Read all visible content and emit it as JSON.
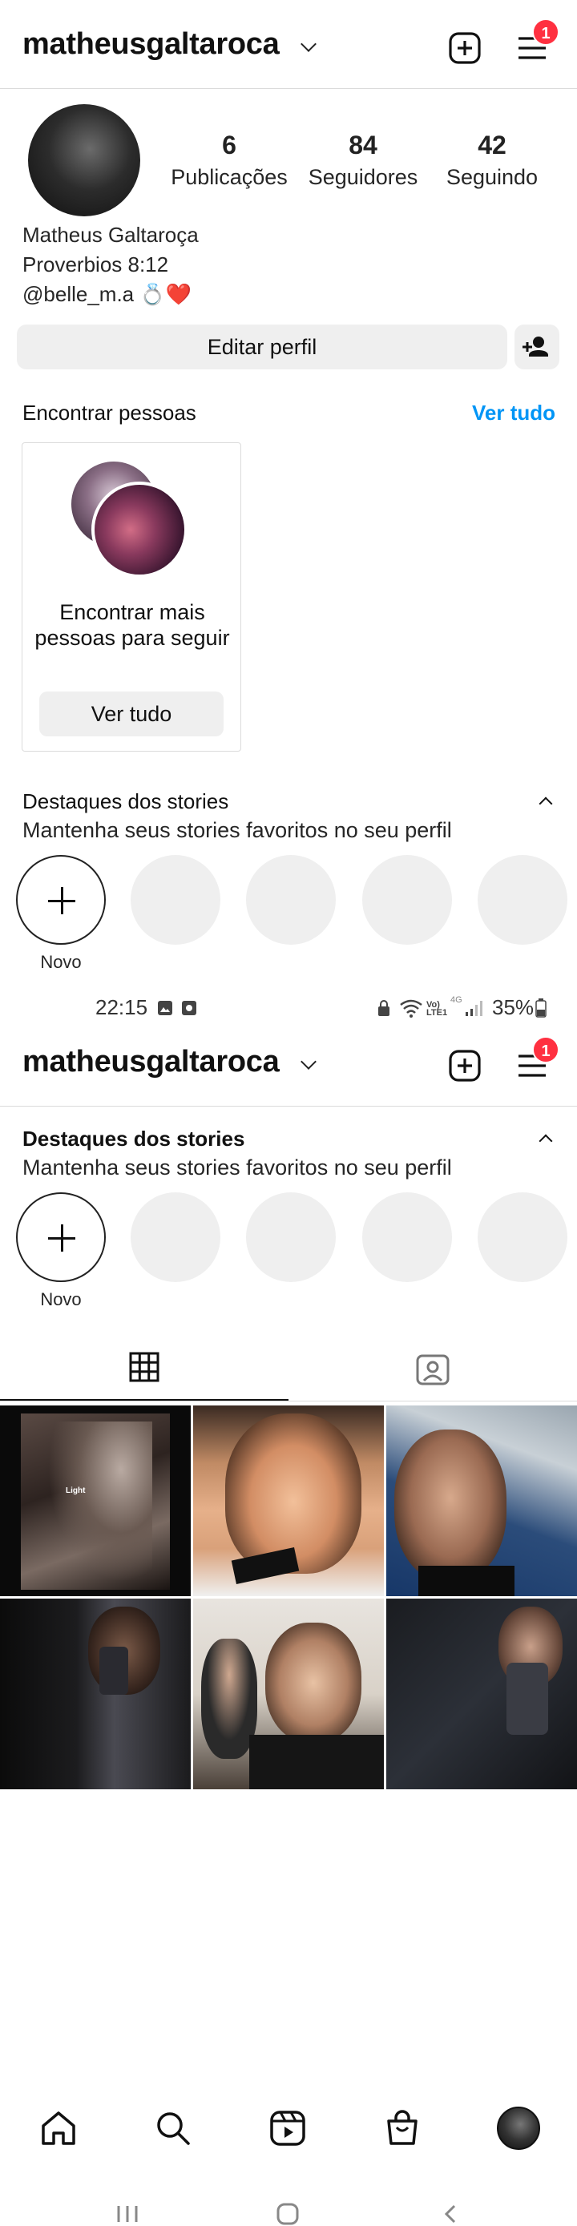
{
  "header": {
    "username": "matheusgaltaroca",
    "notification_count": "1"
  },
  "profile": {
    "stats": [
      {
        "value": "6",
        "label": "Publicações"
      },
      {
        "value": "84",
        "label": "Seguidores"
      },
      {
        "value": "42",
        "label": "Seguindo"
      }
    ],
    "name": "Matheus Galtaroça",
    "bio_line": "Proverbios 8:12",
    "mention": "@belle_m.a 💍❤️",
    "edit_button": "Editar perfil"
  },
  "suggestions": {
    "title": "Encontrar pessoas",
    "see_all": "Ver tudo",
    "card_text": "Encontrar mais pessoas para seguir",
    "card_button": "Ver tudo"
  },
  "highlights": {
    "title": "Destaques dos stories",
    "subtitle": "Mantenha seus stories favoritos no seu perfil",
    "new_label": "Novo"
  },
  "status_bar": {
    "time": "22:15",
    "network": "Vo) LTE1",
    "signal_label": "4G",
    "battery": "35%"
  },
  "tabs": [
    {
      "icon": "grid-icon",
      "active": true
    },
    {
      "icon": "tagged-icon",
      "active": false
    }
  ],
  "grid_posts": [
    {
      "overlay_text": "Light"
    },
    {
      "overlay_text": ""
    },
    {
      "overlay_text": ""
    },
    {
      "overlay_text": ""
    },
    {
      "overlay_text": ""
    },
    {
      "overlay_text": ""
    }
  ],
  "bottom_nav": [
    "home-icon",
    "search-icon",
    "reels-icon",
    "shop-icon",
    "profile-avatar"
  ],
  "colors": {
    "link": "#0095f6",
    "badge": "#ff3040",
    "button_bg": "#efefef",
    "divider": "#dbdbdb"
  }
}
